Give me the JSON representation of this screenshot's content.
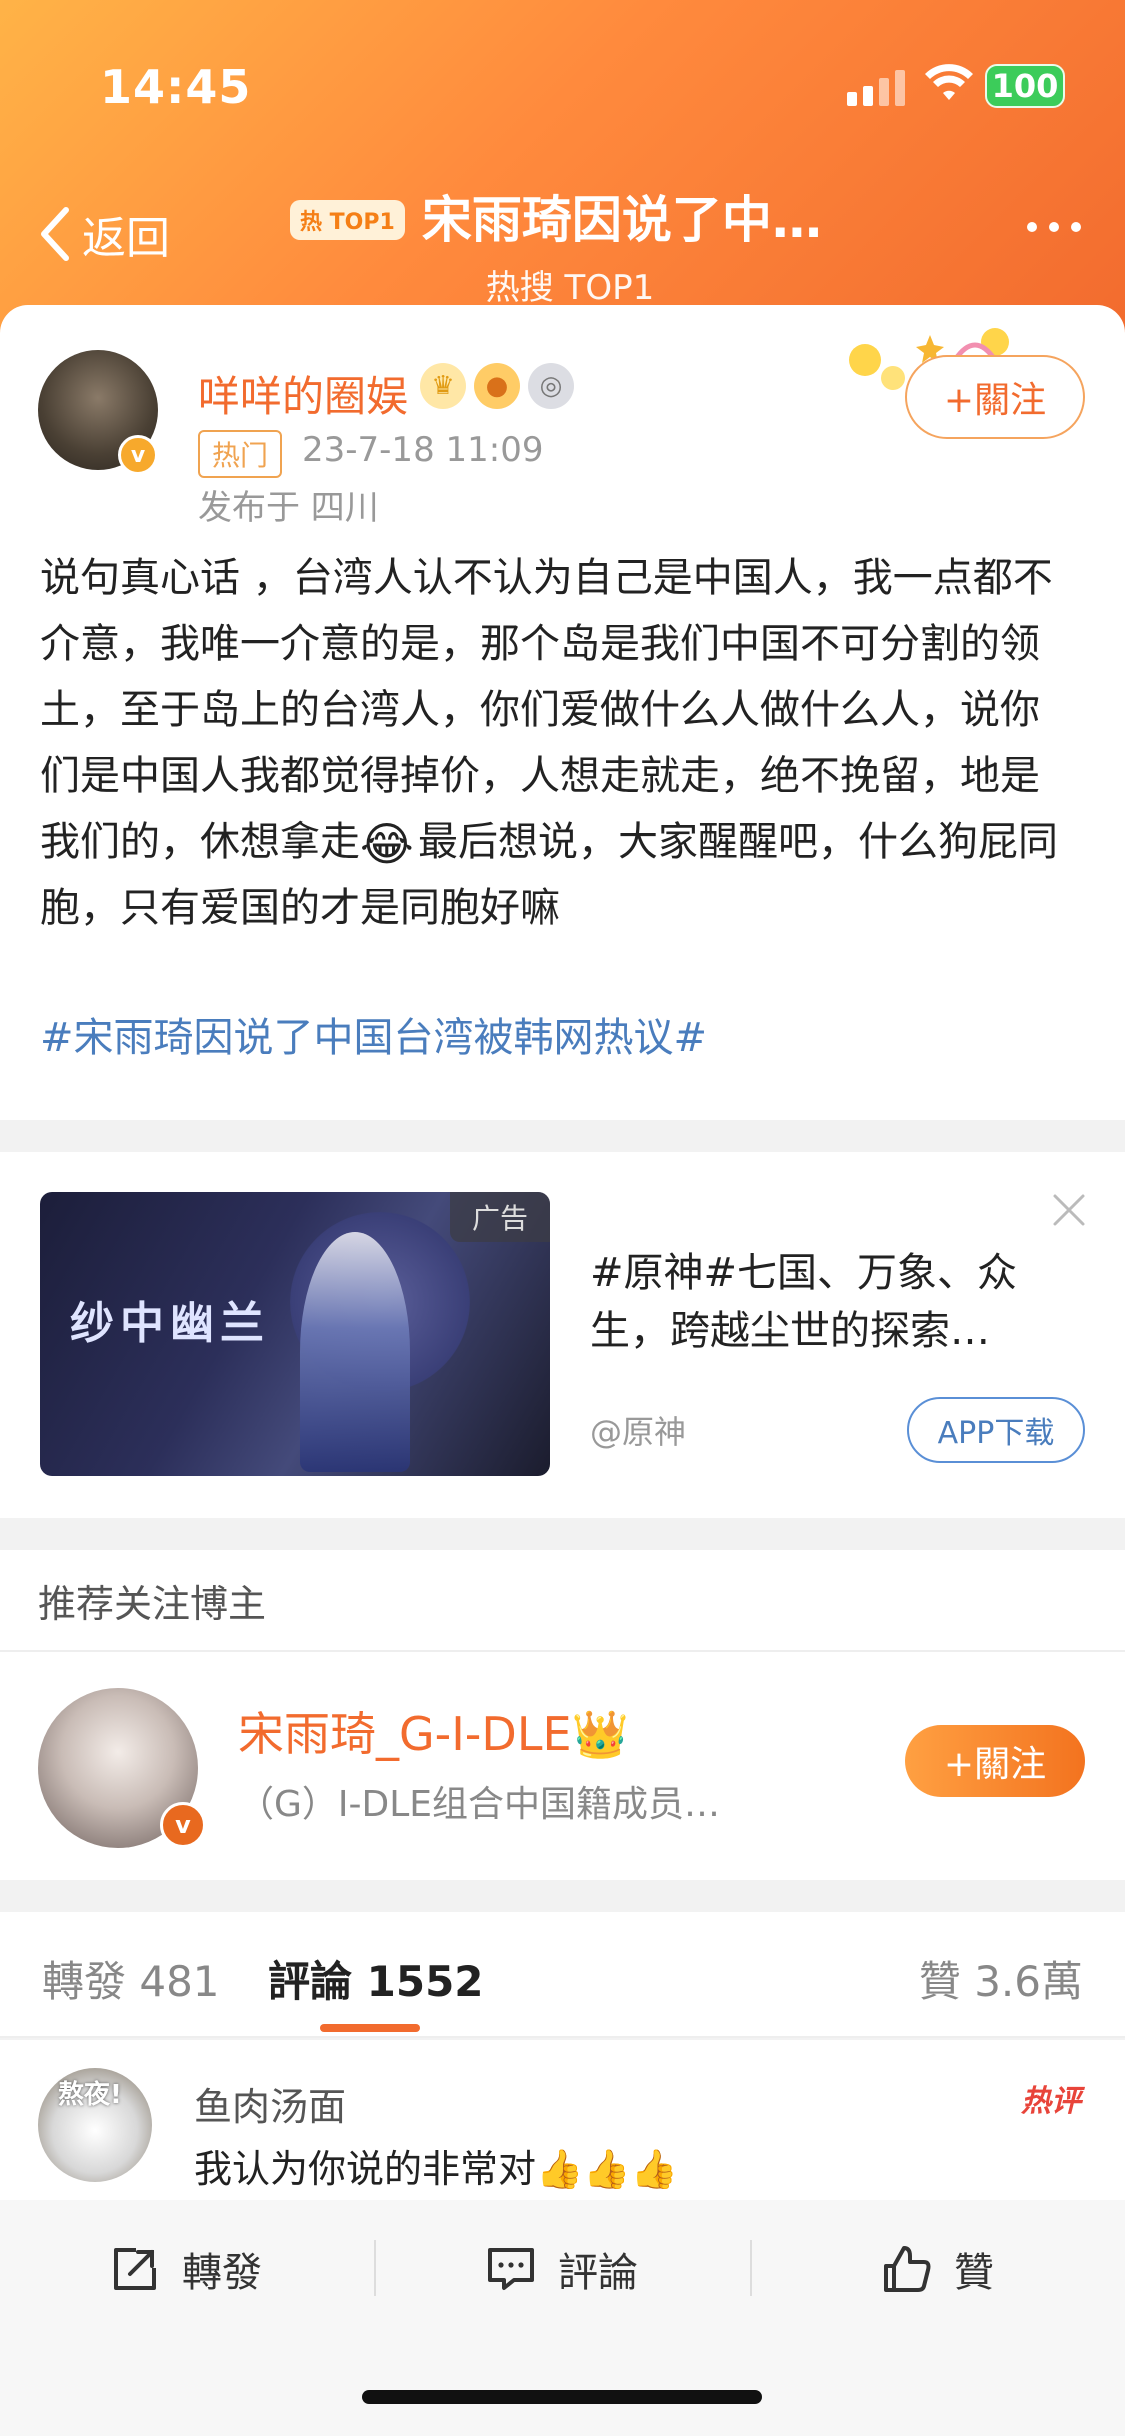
{
  "status": {
    "time": "14:45",
    "battery": "100"
  },
  "nav": {
    "back": "返回",
    "badge": "热 TOP1",
    "title": "宋雨琦因说了中…",
    "subtitle": "热搜 TOP1"
  },
  "post": {
    "author": "咩咩的圈娱",
    "tag": "热门",
    "time": "23-7-18 11:09",
    "location": "发布于 四川",
    "follow": "+關注",
    "text_part1": "说句真心话 ，台湾人认不认为自己是中国人，我一点都不介意，我唯一介意的是，那个岛是我们中国不可分割的领土，至于岛上的台湾人，你们爱做什么人做什么人，说你们是中国人我都觉得掉价，人想走就走，绝不挽留，地是我们的，休想拿走",
    "text_part2": "最后想说，大家醒醒吧，什么狗屁同胞，只有爱国的才是同胞好嘛",
    "emoji": "😂",
    "hashtag": "#宋雨琦因说了中国台湾被韩网热议#"
  },
  "ad": {
    "label": "广告",
    "image_title": "纱中幽兰",
    "title": "#原神#七国、万象、众生，跨越尘世的探索…",
    "source": "@原神",
    "button": "APP下载"
  },
  "recommend": {
    "header": "推荐关注博主",
    "name": "宋雨琦_G-I-DLE👑",
    "desc": "（G）I-DLE组合中国籍成员…",
    "follow": "+關注"
  },
  "tabs": {
    "repost": "轉發 481",
    "comments": "評論 1552",
    "likes": "贊 3.6萬"
  },
  "comment": {
    "avatar_text": "熬夜!",
    "name": "鱼肉汤面",
    "text": "我认为你说的非常对👍👍👍",
    "hot_label": "热评"
  },
  "bottom": {
    "repost": "轉發",
    "comment": "評論",
    "like": "贊"
  },
  "colors": {
    "accent": "#f26b2e",
    "link": "#4a7dbd"
  }
}
